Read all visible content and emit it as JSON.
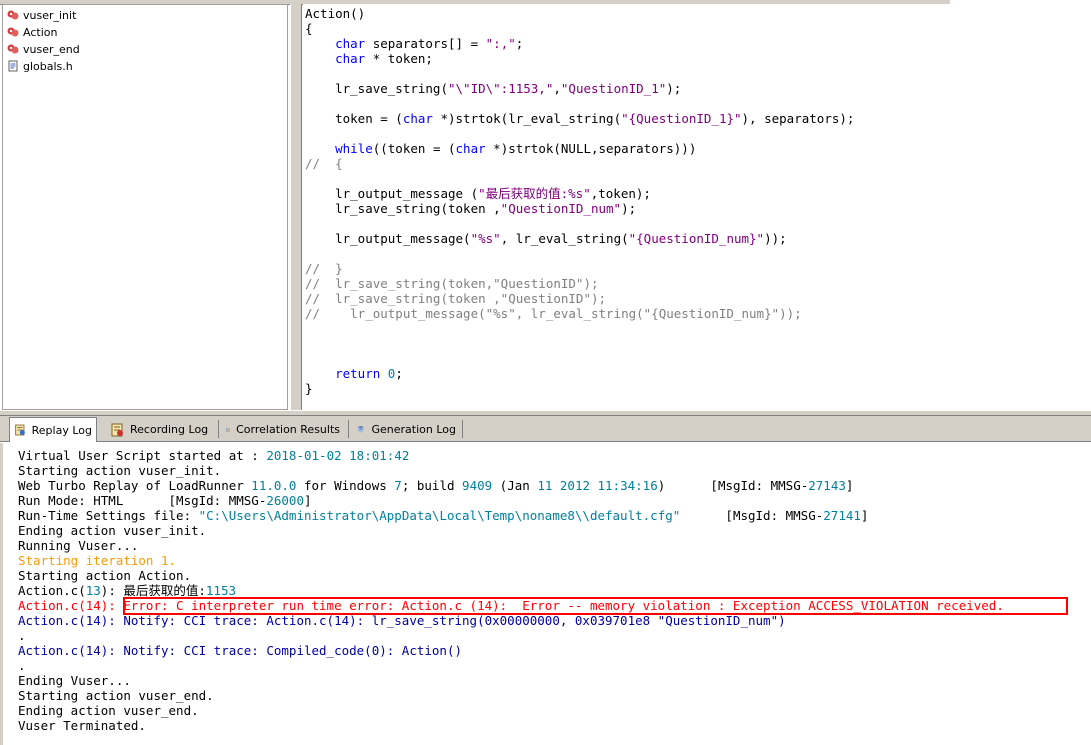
{
  "tree": {
    "items": [
      {
        "label": "vuser_init",
        "icon": "action-icon"
      },
      {
        "label": "Action",
        "icon": "action-icon"
      },
      {
        "label": "vuser_end",
        "icon": "action-icon"
      },
      {
        "label": "globals.h",
        "icon": "header-file-icon"
      }
    ]
  },
  "editor": {
    "lines": [
      "Action()",
      "{",
      "    char separators[] = \":,\";",
      "    char * token;",
      "",
      "    lr_save_string(\"\\\"ID\\\":1153,\",\"QuestionID_1\");",
      "",
      "    token = (char *)strtok(lr_eval_string(\"{QuestionID_1}\"), separators);",
      "",
      "    while((token = (char *)strtok(NULL,separators)))",
      "//  {",
      "",
      "    lr_output_message (\"最后获取的值:%s\",token);",
      "    lr_save_string(token ,\"QuestionID_num\");",
      "",
      "    lr_output_message(\"%s\", lr_eval_string(\"{QuestionID_num}\"));",
      "",
      "//  }",
      "//  lr_save_string(token,\"QuestionID\");",
      "//  lr_save_string(token ,\"QuestionID\");",
      "//    lr_output_message(\"%s\", lr_eval_string(\"{QuestionID_num}\"));",
      "",
      "",
      "",
      "    return 0;",
      "}"
    ]
  },
  "tabs": [
    {
      "label": "Replay Log",
      "icon": "replay-log-icon",
      "active": true
    },
    {
      "label": "Recording Log",
      "icon": "recording-log-icon",
      "active": false
    },
    {
      "label": "Correlation Results",
      "icon": "correlation-icon",
      "active": false
    },
    {
      "label": "Generation Log",
      "icon": "generation-log-icon",
      "active": false
    }
  ],
  "log": {
    "lines": [
      "Virtual User Script started at : 2018-01-02 18:01:42",
      "Starting action vuser_init.",
      "Web Turbo Replay of LoadRunner 11.0.0 for Windows 7; build 9409 (Jan 11 2012 11:34:16)      [MsgId: MMSG-27143]",
      "Run Mode: HTML      [MsgId: MMSG-26000]",
      "Run-Time Settings file: \"C:\\Users\\Administrator\\AppData\\Local\\Temp\\noname8\\\\default.cfg\"      [MsgId: MMSG-27141]",
      "Ending action vuser_init.",
      "Running Vuser...",
      "Starting iteration 1.",
      "Starting action Action.",
      "Action.c(13): 最后获取的值:1153",
      "Action.c(14): Error: C interpreter run time error: Action.c (14):  Error -- memory violation : Exception ACCESS_VIOLATION received.",
      "Action.c(14): Notify: CCI trace: Action.c(14): lr_save_string(0x00000000, 0x039701e8 \"QuestionID_num\")",
      ".",
      "Action.c(14): Notify: CCI trace: Compiled_code(0): Action()",
      ".",
      "Ending Vuser...",
      "Starting action vuser_end.",
      "Ending action vuser_end.",
      "Vuser Terminated."
    ]
  },
  "colors": {
    "keyword": "#0000ff",
    "string": "#800080",
    "comment": "#808080",
    "error": "#ff0000",
    "notify": "#0000a0",
    "iteration": "#ff9900"
  }
}
